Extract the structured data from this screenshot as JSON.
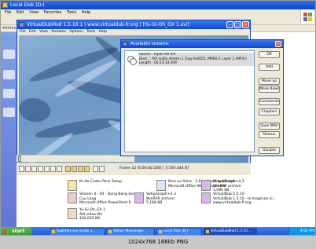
{
  "explorer": {
    "title": "Local Disk (D:)",
    "menu": [
      "File",
      "Edit",
      "View",
      "Favorites",
      "Tools",
      "Help"
    ],
    "address_label": "Addres",
    "files": [
      {
        "name": "K-Lite Codec Pack Setup",
        "sub": ""
      },
      {
        "name": "Kimi no Shiro ‑ 1.04 ‑ Meeting Nisekoi...",
        "sub": "Microsoft Office Word Document"
      },
      {
        "name": "Shonen 4 ‑ 04 ‑ Dong Bang Song",
        "sub": "Cuu Long"
      },
      {
        "name": "Microsoft Office PowerPoint P...",
        "sub": ""
      },
      {
        "name": "SetupGraph+4.3",
        "sub": "WinRAR archive"
      },
      {
        "name": "5,168 KB",
        "sub": ""
      },
      {
        "name": "VirtualGraph+4.3",
        "sub": "WinRAR archive"
      },
      {
        "name": "1,096 KB",
        "sub": ""
      },
      {
        "name": "VirtualDub-1.5.10",
        "sub": "WinRAR archive"
      },
      {
        "name": "VirtualDub 1.5.10 ‑ le-magician.vi...",
        "sub": "www.virtualdub-fr.org"
      },
      {
        "name": "Yu-Gi-Oh_GX 1",
        "sub": "AVI video file"
      },
      {
        "name": "192,035 KB",
        "sub": ""
      }
    ]
  },
  "virtualdub": {
    "title": "VirtualDubMod 1.5.10.1  |  www.virtualdub-fr.org  |  [Yu-Gi-Oh_GX 1.avi]",
    "menu": [
      "File",
      "Edit",
      "View",
      "Streams",
      "Options",
      "Tools",
      "Help"
    ],
    "frame_info": "Frame 12 [0:00:00.500] [ ] [193.444 B]"
  },
  "dialog": {
    "title": "Available streams",
    "stream": {
      "source": "Source : Input AVI file",
      "desc": "Desc. : AVI audio stream 1 [tag 0x0055, MPEG-1 Layer 3 (MP3)]",
      "length": "Length : 00:23:14.009"
    },
    "buttons": {
      "ok": "OK",
      "add": "Add",
      "move_up": "Move up",
      "move_down": "Move down",
      "comments": "Comments",
      "chapters": "Chapters",
      "save_wav": "Save WAV",
      "demux": "Demux",
      "disable": "Disable"
    }
  },
  "taskbar": {
    "start": "start",
    "items": [
      "Subtitles are inside a...",
      "Yahoo! Messenger",
      "Local Disk (D:)",
      "VirtualDubMod 1.5.10..."
    ],
    "clock": "4:02 PM"
  },
  "caption": "1024x768 188kb PNG"
}
